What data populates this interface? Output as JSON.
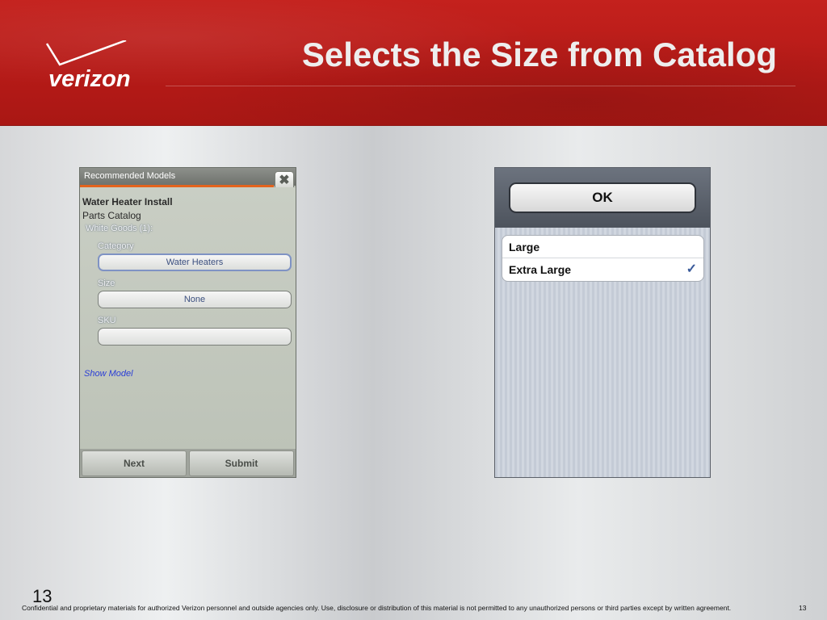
{
  "header": {
    "logo_text": "verizon",
    "title": "Selects the Size from Catalog"
  },
  "left_screen": {
    "titlebar": "Recommended Models",
    "close_glyph": "✖",
    "heading": "Water Heater Install",
    "subheading": "Parts Catalog",
    "section_label": "White Goods (1):",
    "category_label": "Category",
    "category_value": "Water Heaters",
    "size_label": "Size",
    "size_value": "None",
    "sku_label": "SKU",
    "sku_value": "",
    "show_model_link": "Show Model",
    "next_button": "Next",
    "submit_button": "Submit"
  },
  "right_screen": {
    "ok_button": "OK",
    "options": [
      {
        "label": "Large",
        "selected": false
      },
      {
        "label": "Extra Large",
        "selected": true
      }
    ],
    "check_glyph": "✓"
  },
  "footer": {
    "page_number": "13",
    "disclaimer": "Confidential and proprietary materials for authorized Verizon personnel and outside agencies only. Use, disclosure or distribution of this material is not permitted to any unauthorized persons or third parties except by written agreement.",
    "page_number_small": "13"
  },
  "colors": {
    "brand_red": "#c4211d",
    "accent_orange": "#e4631d",
    "link_blue": "#2a3ed6",
    "check_blue": "#3a5a9a"
  }
}
